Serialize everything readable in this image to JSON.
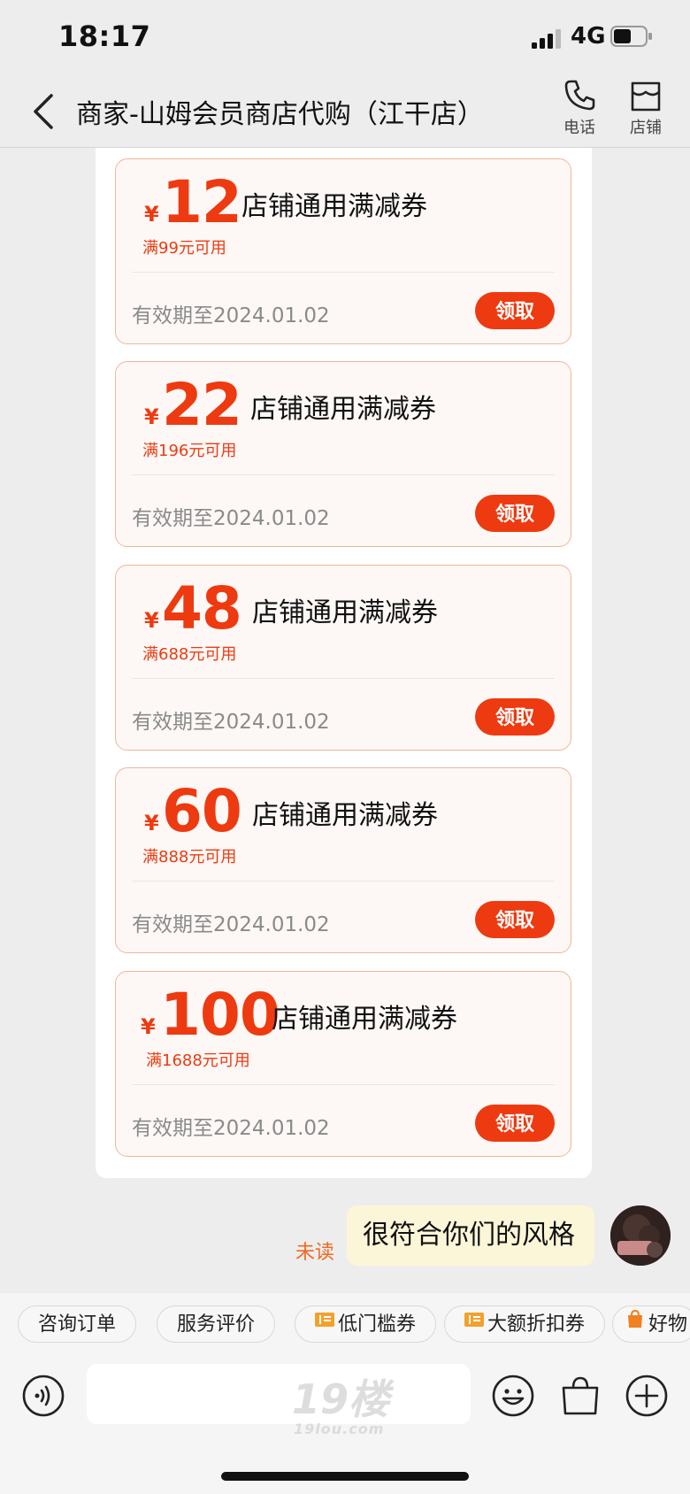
{
  "status_bar": {
    "time": "18:17",
    "network": "4G"
  },
  "header": {
    "title": "商家-山姆会员商店代购（江干店）",
    "phone_label": "电话",
    "store_label": "店铺"
  },
  "coupons": [
    {
      "currency": "¥",
      "amount": "12",
      "name": "店铺通用满减券",
      "condition": "满99元可用",
      "validity": "有效期至2024.01.02",
      "button": "领取"
    },
    {
      "currency": "¥",
      "amount": "22",
      "name": "店铺通用满减券",
      "condition": "满196元可用",
      "validity": "有效期至2024.01.02",
      "button": "领取"
    },
    {
      "currency": "¥",
      "amount": "48",
      "name": "店铺通用满减券",
      "condition": "满688元可用",
      "validity": "有效期至2024.01.02",
      "button": "领取"
    },
    {
      "currency": "¥",
      "amount": "60",
      "name": "店铺通用满减券",
      "condition": "满888元可用",
      "validity": "有效期至2024.01.02",
      "button": "领取"
    },
    {
      "currency": "¥",
      "amount": "100",
      "name": "店铺通用满减券",
      "condition": "满1688元可用",
      "validity": "有效期至2024.01.02",
      "button": "领取"
    }
  ],
  "message": {
    "unread_label": "未读",
    "text": "很符合你们的风格"
  },
  "quick_chips": [
    {
      "label": "咨询订单",
      "icon": ""
    },
    {
      "label": "服务评价",
      "icon": ""
    },
    {
      "label": "低门槛券",
      "icon": "coupon-icon"
    },
    {
      "label": "大额折扣券",
      "icon": "coupon-icon"
    },
    {
      "label": "好物",
      "icon": "shopping-bag-icon"
    }
  ],
  "input": {
    "placeholder": ""
  },
  "watermark": {
    "main": "19楼",
    "sub": "19lou.com"
  },
  "colors": {
    "accent": "#ee3a10",
    "bubble": "#fcf6d8",
    "unread": "#ee6a20"
  }
}
